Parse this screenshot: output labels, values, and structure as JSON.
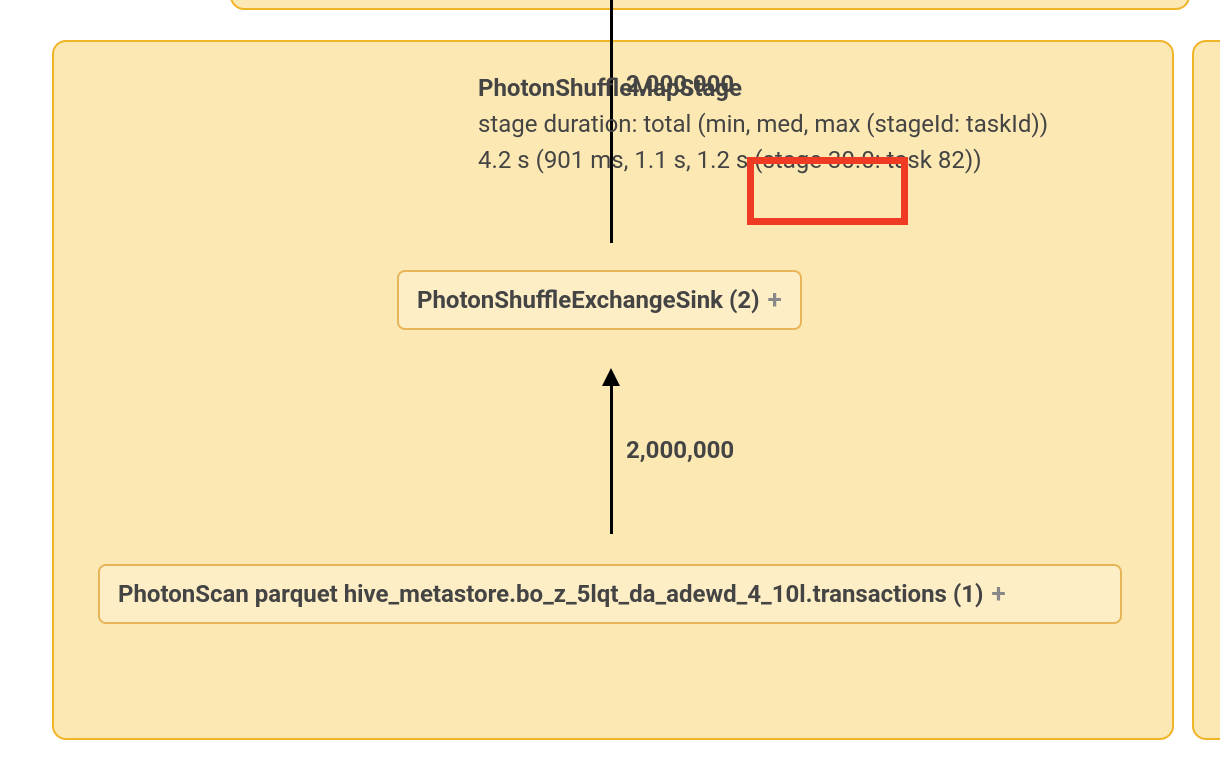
{
  "top_count": "2,000,000",
  "stage_info": {
    "title": "PhotonShuffleMapStage",
    "line1": "stage duration: total (min, med, max (stageId: taskId))",
    "line2": "4.2 s (901 ms, 1.1 s, 1.2 s (stage 30.0: task 82))"
  },
  "node_sink": {
    "label": "PhotonShuffleExchangeSink (2)"
  },
  "mid_count": "2,000,000",
  "node_scan": {
    "label": "PhotonScan parquet hive_metastore.bo_z_5lqt_da_adewd_4_10l.transactions (1)"
  }
}
